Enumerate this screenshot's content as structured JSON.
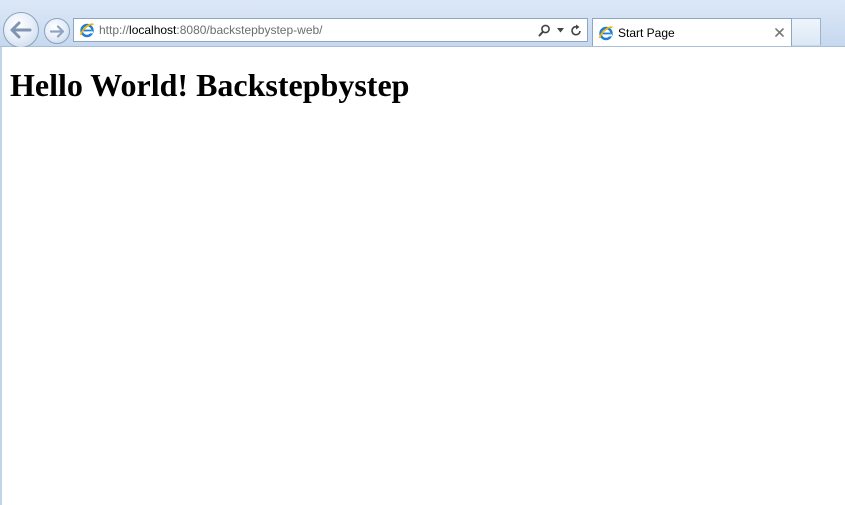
{
  "browser": {
    "address_bar": {
      "url_prefix": "http://",
      "url_host": "localhost",
      "url_rest": ":8080/backstepbystep-web/"
    },
    "tabs": [
      {
        "title": "Start Page"
      }
    ],
    "icons": {
      "back": "back-arrow-icon",
      "forward": "forward-arrow-icon",
      "page": "ie-logo-icon",
      "search": "search-icon",
      "dropdown": "chevron-down-icon",
      "refresh": "refresh-icon",
      "close": "close-icon"
    },
    "colors": {
      "chrome": "#cfdff2",
      "border": "#8ea6c2"
    }
  },
  "page": {
    "heading": "Hello World! Backstepbystep"
  }
}
